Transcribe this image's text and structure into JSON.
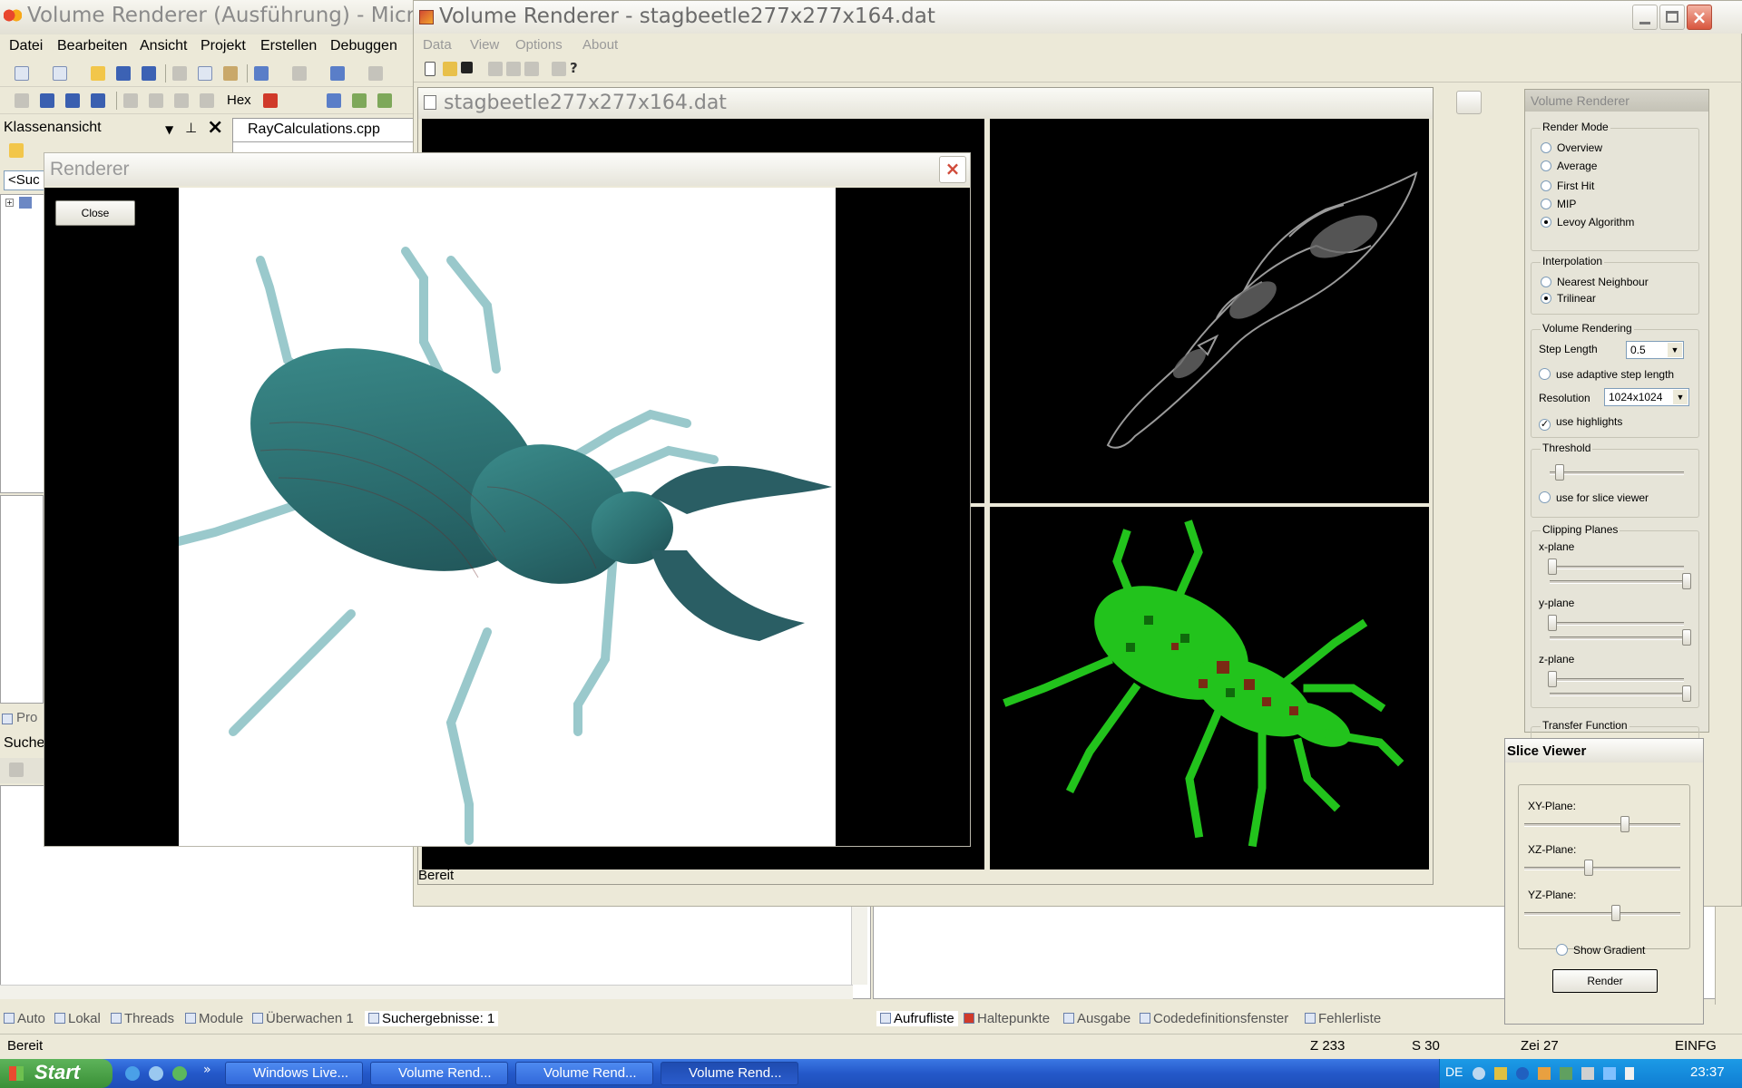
{
  "vs": {
    "title": "Volume Renderer (Ausführung) - Micr",
    "menu": [
      "Datei",
      "Bearbeiten",
      "Ansicht",
      "Projekt",
      "Erstellen",
      "Debuggen"
    ],
    "hex_label": "Hex",
    "class_view_title": "Klassenansicht",
    "search_placeholder": "<Suc",
    "file_tab": "RayCalculations.cpp",
    "pro_label": "Pro",
    "suche_label": "Suche",
    "bottom_tabs_left": [
      "Auto",
      "Lokal",
      "Threads",
      "Module",
      "Überwachen 1",
      "Suchergebnisse: 1"
    ],
    "bottom_tabs_right": [
      "Aufrufliste",
      "Haltepunkte",
      "Ausgabe",
      "Codedefinitionsfenster",
      "Fehlerliste"
    ],
    "status": {
      "ready": "Bereit",
      "line": "Z 233",
      "col": "S 30",
      "char": "Zei 27",
      "mode": "EINFG"
    }
  },
  "app": {
    "title": "Volume Renderer - stagbeetle277x277x164.dat",
    "menu": [
      "Data",
      "View",
      "Options",
      "About"
    ],
    "doc_title": "stagbeetle277x277x164.dat",
    "status": "Bereit"
  },
  "panel": {
    "title": "Volume Renderer",
    "render_mode": {
      "title": "Render Mode",
      "options": [
        "Overview",
        "Average",
        "First Hit",
        "MIP",
        "Levoy Algorithm"
      ],
      "selected": "Levoy Algorithm"
    },
    "interpolation": {
      "title": "Interpolation",
      "options": [
        "Nearest Neighbour",
        "Trilinear"
      ],
      "selected": "Trilinear"
    },
    "volume_rendering": {
      "title": "Volume Rendering",
      "step_length_label": "Step Length",
      "step_length": "0.5",
      "adaptive_label": "use adaptive step length",
      "adaptive": false,
      "resolution_label": "Resolution",
      "resolution": "1024x1024",
      "highlights_label": "use highlights",
      "highlights": true
    },
    "threshold": {
      "title": "Threshold",
      "value": 0.1,
      "slice_viewer_label": "use for slice viewer",
      "slice_viewer": false
    },
    "clipping": {
      "title": "Clipping Planes",
      "planes": [
        {
          "label": "x-plane",
          "min": 0.0,
          "max": 1.0
        },
        {
          "label": "y-plane",
          "min": 0.0,
          "max": 1.0
        },
        {
          "label": "z-plane",
          "min": 0.0,
          "max": 1.0
        }
      ]
    },
    "transfer_function": "Transfer Function"
  },
  "renderer": {
    "title": "Renderer",
    "close_label": "Close"
  },
  "slice_viewer": {
    "title": "Slice Viewer",
    "sliders": [
      {
        "label": "XY-Plane:",
        "value": 0.65
      },
      {
        "label": "XZ-Plane:",
        "value": 0.42
      },
      {
        "label": "YZ-Plane:",
        "value": 0.6
      }
    ],
    "gradient_label": "Show Gradient",
    "gradient": false,
    "render_label": "Render"
  },
  "taskbar": {
    "start": "Start",
    "buttons": [
      "Windows Live...",
      "Volume Rend...",
      "Volume Rend...",
      "Volume Rend..."
    ],
    "lang": "DE",
    "clock": "23:37"
  }
}
